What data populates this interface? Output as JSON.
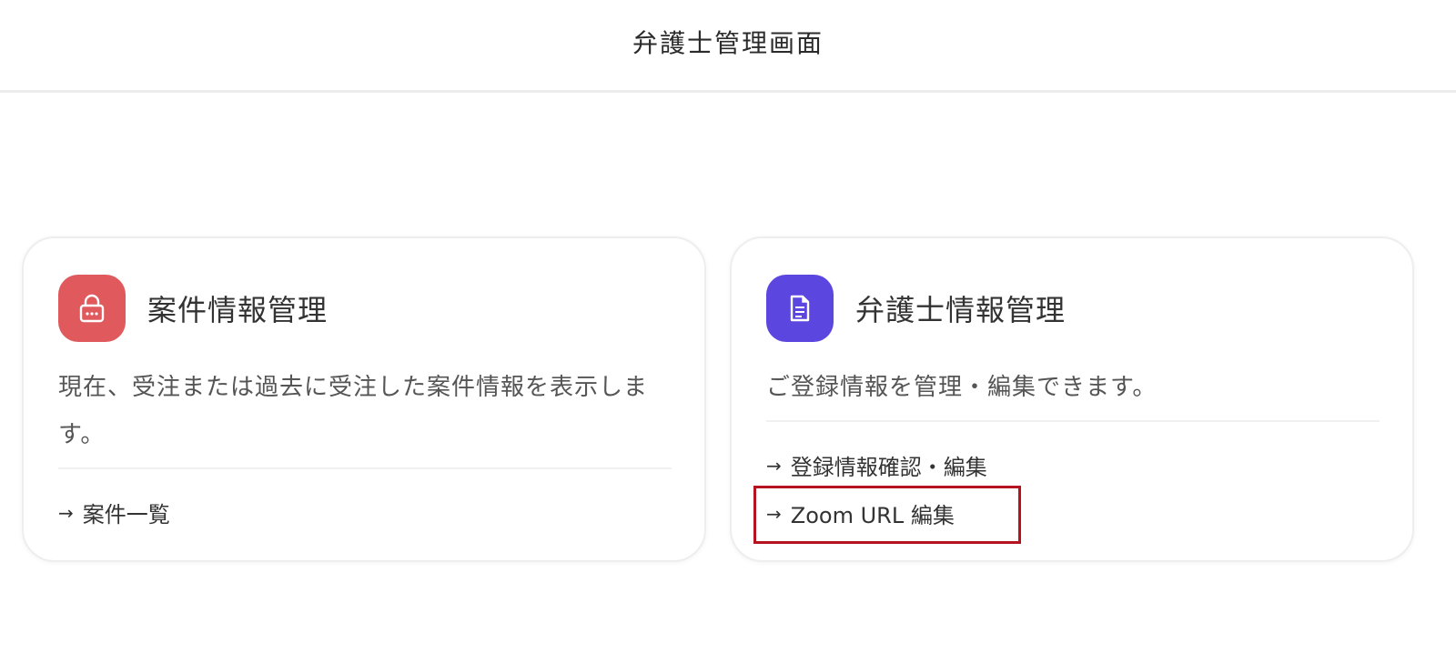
{
  "header": {
    "title": "弁護士管理画面"
  },
  "cards": {
    "left": {
      "title": "案件情報管理",
      "description": "現在、受注または過去に受注した案件情報を表示します。",
      "icon": "lock-icon",
      "icon_color": "#e05a5d",
      "links": [
        {
          "arrow": "→",
          "label": "案件一覧"
        }
      ]
    },
    "right": {
      "title": "弁護士情報管理",
      "description": "ご登録情報を管理・編集できます。",
      "icon": "document-icon",
      "icon_color": "#5b46e0",
      "links": [
        {
          "arrow": "→",
          "label": "登録情報確認・編集"
        },
        {
          "arrow": "→",
          "label": "Zoom URL 編集"
        }
      ]
    }
  },
  "annotation": {
    "highlight_color": "#b3141f"
  }
}
